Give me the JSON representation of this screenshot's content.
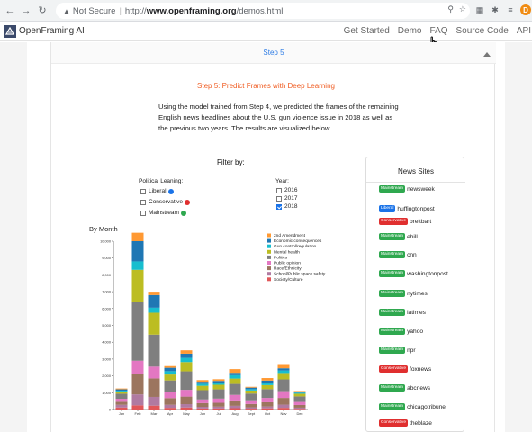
{
  "browser": {
    "not_secure": "Not Secure",
    "url_scheme": "http://",
    "url_host": "www.openframing.org",
    "url_path": "/demos.html",
    "profile_initial": "D"
  },
  "nav": {
    "brand": "OpenFraming AI",
    "links": [
      "Get Started",
      "Demo",
      "FAQ",
      "Source Code",
      "API"
    ]
  },
  "step_header": "Step 5",
  "step_title": "Step 5: Predict Frames with Deep Learning",
  "description": "Using the model trained from Step 4, we predicted the frames of the remaining English news headlines about the U.S. gun violence issue in 2018 as well as the previous two years. The results are visualized below.",
  "filter": {
    "title": "Filter by:",
    "political_label": "Political Leaning:",
    "political_options": [
      {
        "label": "Liberal",
        "color": "#1a73e8",
        "checked": false
      },
      {
        "label": "Conservative",
        "color": "#e02f2f",
        "checked": false
      },
      {
        "label": "Mainstream",
        "color": "#2fa84f",
        "checked": false
      }
    ],
    "year_label": "Year:",
    "year_options": [
      {
        "label": "2016",
        "checked": false
      },
      {
        "label": "2017",
        "checked": false
      },
      {
        "label": "2018",
        "checked": true
      }
    ]
  },
  "chart_title": "By Month",
  "chart_data": {
    "type": "bar",
    "stacked": true,
    "categories": [
      "Jan",
      "Feb",
      "Mar",
      "Apr",
      "May",
      "Jun",
      "Jul",
      "Aug",
      "Sept",
      "Oct",
      "Nov",
      "Dec"
    ],
    "ylim": [
      0,
      10000
    ],
    "yticks": [
      "0",
      "1,000",
      "2,000",
      "3,000",
      "4,000",
      "5,000",
      "6,000",
      "7,000",
      "8,000",
      "9,000",
      "10,000"
    ],
    "series": [
      {
        "name": "Society/Culture",
        "color": "#e15759",
        "values": [
          120,
          250,
          230,
          100,
          120,
          60,
          60,
          80,
          50,
          70,
          100,
          40
        ]
      },
      {
        "name": "School/Public space safety",
        "color": "#b07aa1",
        "values": [
          160,
          650,
          520,
          180,
          200,
          100,
          110,
          140,
          80,
          110,
          190,
          70
        ]
      },
      {
        "name": "Race/Ethnicity",
        "color": "#9c755f",
        "values": [
          180,
          1200,
          1100,
          400,
          450,
          220,
          230,
          320,
          200,
          250,
          400,
          160
        ]
      },
      {
        "name": "Public opinion",
        "color": "#e377c2",
        "values": [
          180,
          800,
          700,
          350,
          400,
          220,
          250,
          330,
          220,
          260,
          400,
          180
        ]
      },
      {
        "name": "Politics",
        "color": "#7f7f7f",
        "values": [
          300,
          3500,
          1900,
          700,
          1100,
          550,
          550,
          650,
          400,
          520,
          700,
          330
        ]
      },
      {
        "name": "Mental health",
        "color": "#bcbd22",
        "values": [
          100,
          1900,
          1300,
          350,
          550,
          260,
          270,
          320,
          180,
          240,
          380,
          160
        ]
      },
      {
        "name": "Gun control/regulation",
        "color": "#17becf",
        "values": [
          80,
          500,
          300,
          200,
          250,
          120,
          120,
          200,
          80,
          150,
          150,
          60
        ]
      },
      {
        "name": "Economic consequences",
        "color": "#1f77b4",
        "values": [
          80,
          1200,
          750,
          200,
          250,
          120,
          110,
          140,
          90,
          120,
          130,
          60
        ]
      },
      {
        "name": "2nd Amendment",
        "color": "#ff9933",
        "values": [
          50,
          500,
          200,
          100,
          200,
          100,
          100,
          220,
          50,
          150,
          250,
          40
        ]
      }
    ]
  },
  "news_sites": {
    "title": "News Sites",
    "items": [
      {
        "badge": "Mainstream",
        "color": "#2fa84f",
        "name": "newsweek"
      },
      {
        "badge": "Liberal",
        "color": "#1a73e8",
        "name": "huffingtonpost"
      },
      {
        "badge": "Conservative",
        "color": "#e02f2f",
        "name": "breitbart"
      },
      {
        "badge": "Mainstream",
        "color": "#2fa84f",
        "name": "ehill"
      },
      {
        "badge": "Mainstream",
        "color": "#2fa84f",
        "name": "cnn"
      },
      {
        "badge": "Mainstream",
        "color": "#2fa84f",
        "name": "washingtonpost"
      },
      {
        "badge": "Mainstream",
        "color": "#2fa84f",
        "name": "nytimes"
      },
      {
        "badge": "Mainstream",
        "color": "#2fa84f",
        "name": "latimes"
      },
      {
        "badge": "Mainstream",
        "color": "#2fa84f",
        "name": "yahoo"
      },
      {
        "badge": "Mainstream",
        "color": "#2fa84f",
        "name": "npr"
      },
      {
        "badge": "Conservative",
        "color": "#e02f2f",
        "name": "foxnews"
      },
      {
        "badge": "Mainstream",
        "color": "#2fa84f",
        "name": "abcnews"
      },
      {
        "badge": "Mainstream",
        "color": "#2fa84f",
        "name": "chicagotribune"
      },
      {
        "badge": "Conservative",
        "color": "#e02f2f",
        "name": "theblaze"
      }
    ]
  }
}
